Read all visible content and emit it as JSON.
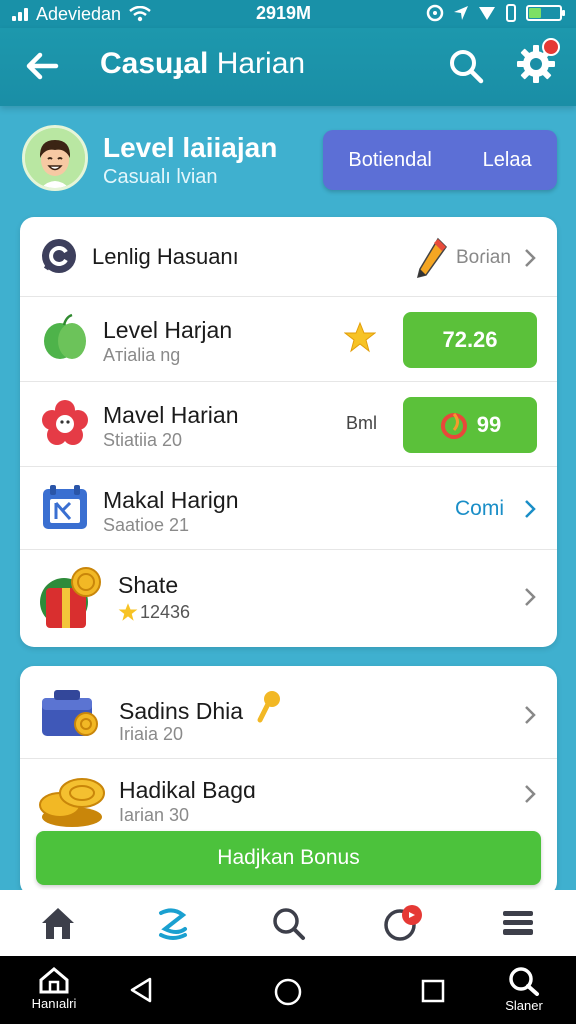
{
  "status_bar": {
    "carrier": "Adeviedan",
    "time": "2919M"
  },
  "header": {
    "title_bold": "Casuɟal",
    "title_rest": " Harian"
  },
  "profile": {
    "title": "Level laiiajan",
    "subtitle": "Casualı lvian",
    "button_left": "Botiendal",
    "button_right": "Lelaa"
  },
  "card1": {
    "rows": [
      {
        "title": "Lenlig Hasuanı",
        "right": "Boɾian",
        "icon": "chat-icon",
        "right_icon": "pencil-icon"
      },
      {
        "title": "Level Harjan",
        "subtitle": "Aᴛialia ng",
        "value": "72.26",
        "icon": "leaf-icon",
        "mid_icon": "star-icon"
      },
      {
        "title": "Mavel Harian",
        "subtitle": "Stiatiia 20",
        "mid_text": "Bml",
        "value": "99",
        "icon": "flower-icon",
        "value_icon": "flame-icon"
      },
      {
        "title": "Makal Harign",
        "subtitle": "Saatioe 21",
        "right": "Comi",
        "icon": "calendar-icon"
      },
      {
        "title": "Shate",
        "subtitle": "12436",
        "icon": "gift-icon",
        "sub_icon": "star-icon"
      }
    ]
  },
  "card2": {
    "rows": [
      {
        "title": "Sadins Dhia",
        "subtitle": "Iriaia 20",
        "icon": "chest-icon"
      },
      {
        "title": "Hadikal Bagɑ",
        "subtitle": "Iarian 30",
        "icon": "coins-icon"
      }
    ]
  },
  "cta": {
    "label": "Hadjkan Bonus"
  },
  "bottom_nav": [
    "home-icon",
    "activity-icon",
    "search-icon",
    "notification-icon",
    "menu-icon"
  ],
  "system_nav": {
    "left_label": "Hanıalri",
    "right_label": "Slaner"
  },
  "colors": {
    "header": "#1a8ea6",
    "background": "#3fb0cf",
    "accent_blue": "#5c6fd6",
    "green": "#5bc13a"
  }
}
